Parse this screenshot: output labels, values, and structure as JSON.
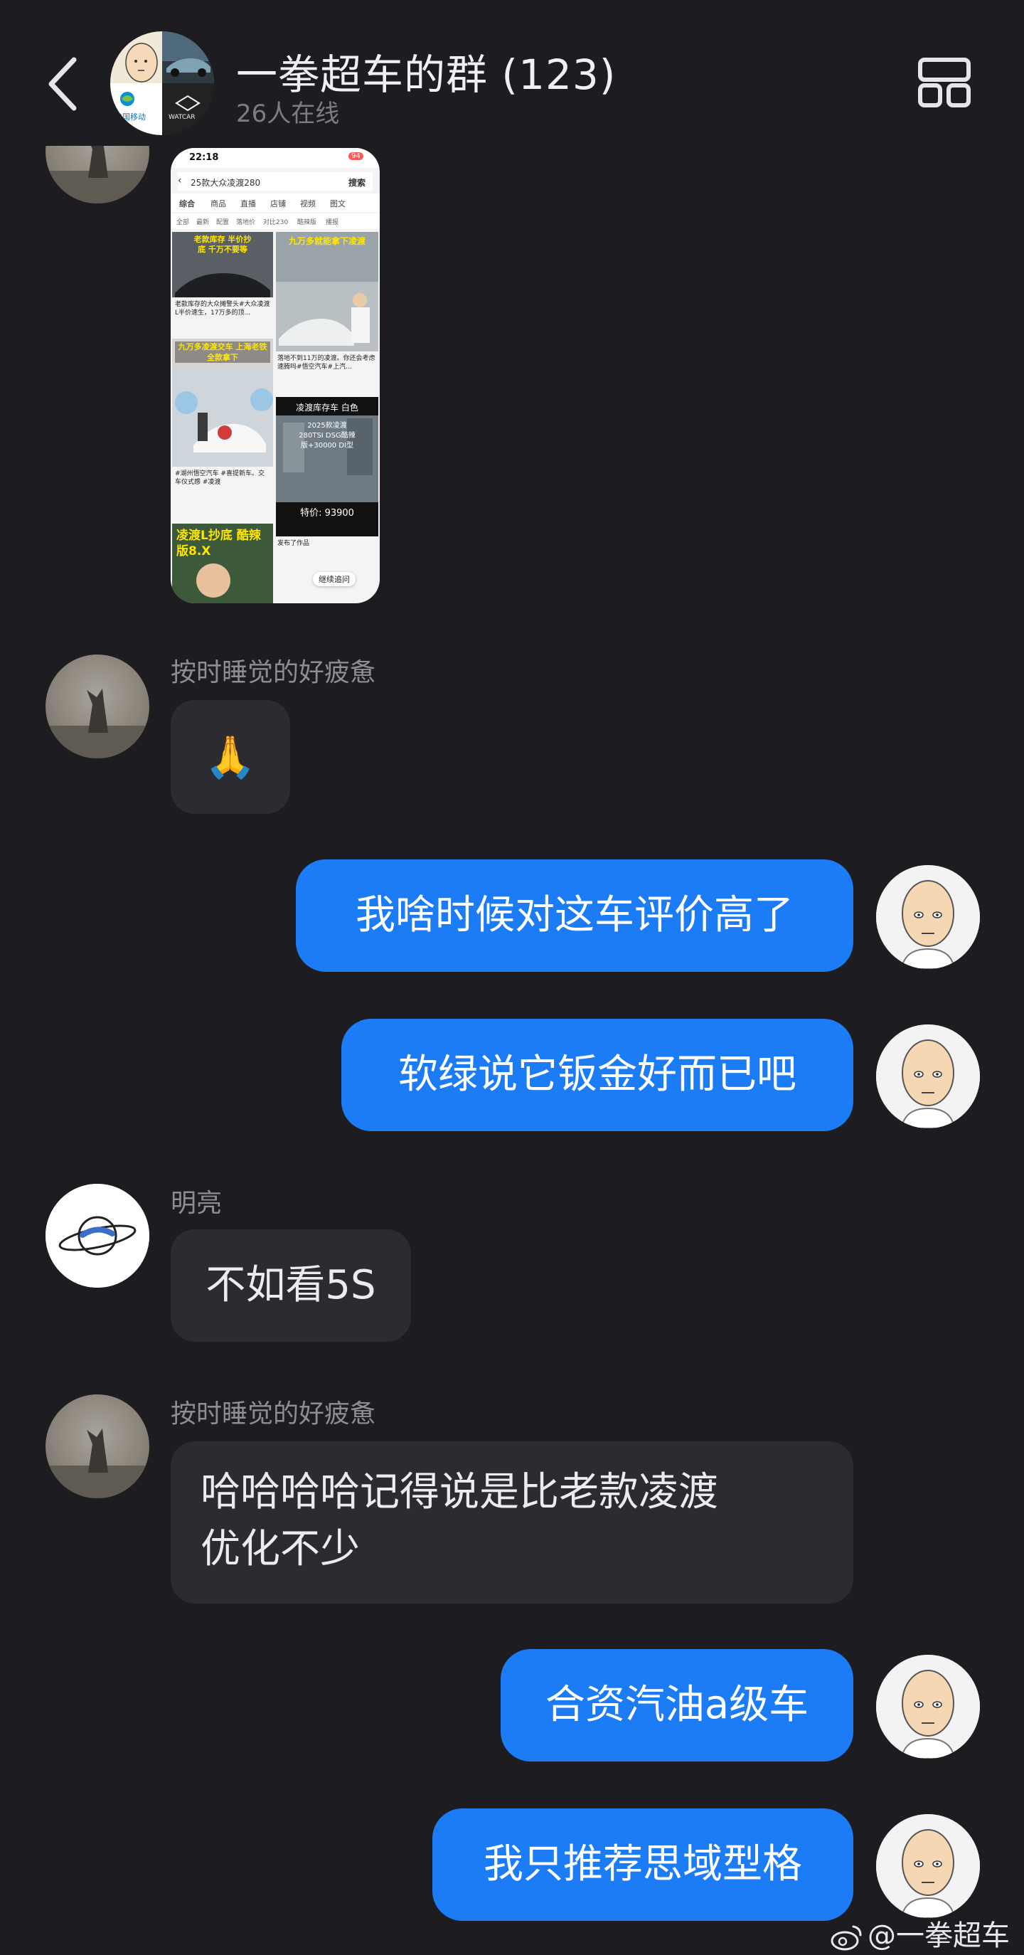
{
  "header": {
    "title": "一拳超车的群 (123)",
    "subtitle": "26人在线",
    "group_avatar_text_1": "中国移动",
    "group_avatar_text_2": "WATCAR"
  },
  "messages": {
    "shared_screenshot": {
      "status_time": "22:18",
      "status_badge": "94",
      "search_query": "25款大众凌渡280",
      "search_button": "搜索",
      "tabs": [
        "综合",
        "商品",
        "直播",
        "店铺",
        "视频",
        "图文"
      ],
      "chips": [
        "全部",
        "最新",
        "配置",
        "落地价",
        "对比230",
        "酷辣版",
        "播报"
      ],
      "tile1_overlay": "老款库存 半价抄底 千万不要等",
      "tile1_caption": "老款库存的大众摊警头#大众凌渡L半价速生，17万多的顶...",
      "tile2_overlay": "九万多就能拿下凌渡",
      "tile2_caption": "落地不到11万的凌渡。你还会考虑速腾吗#悟空汽车#上汽...",
      "tile3_overlay": "九万多凌渡交车 上海老铁全款拿下",
      "tile3_caption": "#湖州悟空汽车 #喜提新车。交车仪式感 #凌渡",
      "tile4_header": "凌渡库存车 白色",
      "tile4_lines": [
        "2025款凌渡",
        "280TSI DSG酷辣",
        "版+30000 DI型",
        "特价: 93900"
      ],
      "tile4_price": "特价: 93900",
      "tile4_caption": "发布了作品",
      "tile5_overlay": "凌渡L抄底 酷辣版8.X",
      "continue_chip": "继续追问"
    },
    "m1": {
      "sender": "按时睡觉的好疲惫",
      "text": "🙏"
    },
    "m2": {
      "text": "我啥时候对这车评价高了"
    },
    "m3": {
      "text": "软绿说它钣金好而已吧"
    },
    "m4": {
      "sender": "明亮",
      "text": "不如看5S"
    },
    "m5": {
      "sender": "按时睡觉的好疲惫",
      "line1": "哈哈哈哈记得说是比老款凌渡",
      "line2": "优化不少"
    },
    "m6": {
      "text": "合资汽油a级车"
    },
    "m7": {
      "text": "我只推荐思域型格"
    }
  },
  "watermark": "@一拳超车",
  "colors": {
    "background": "#1c1c21",
    "incoming_bubble": "#2b2b30",
    "outgoing_bubble": "#1b7cf5",
    "sender_name": "#8d8d93"
  }
}
